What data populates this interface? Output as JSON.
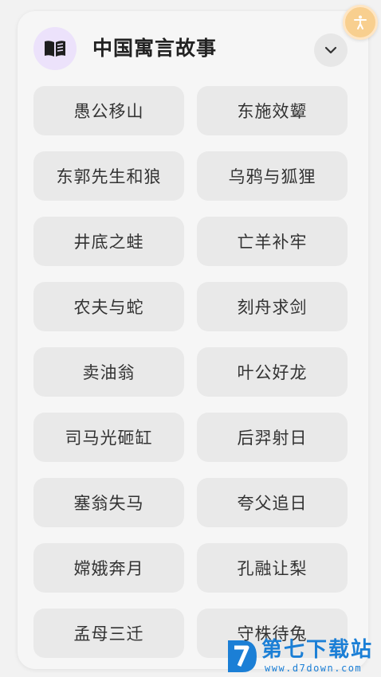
{
  "header": {
    "title": "中国寓言故事",
    "book_icon": "open-book-icon",
    "collapse_icon": "chevron-down-icon"
  },
  "stories": [
    "愚公移山",
    "东施效颦",
    "东郭先生和狼",
    "乌鸦与狐狸",
    "井底之蛙",
    "亡羊补牢",
    "农夫与蛇",
    "刻舟求剑",
    "卖油翁",
    "叶公好龙",
    "司马光砸缸",
    "后羿射日",
    "塞翁失马",
    "夸父追日",
    "嫦娥奔月",
    "孔融让梨",
    "孟母三迁",
    "守株待兔"
  ],
  "accessibility": {
    "icon": "accessibility-person-icon"
  },
  "watermark": {
    "text": "第七下载站",
    "url": "www.d7down.com"
  },
  "colors": {
    "accent_badge": "#ece2fb",
    "accessibility_bg": "#f8cf8f",
    "watermark_blue": "#1b7fd6"
  }
}
